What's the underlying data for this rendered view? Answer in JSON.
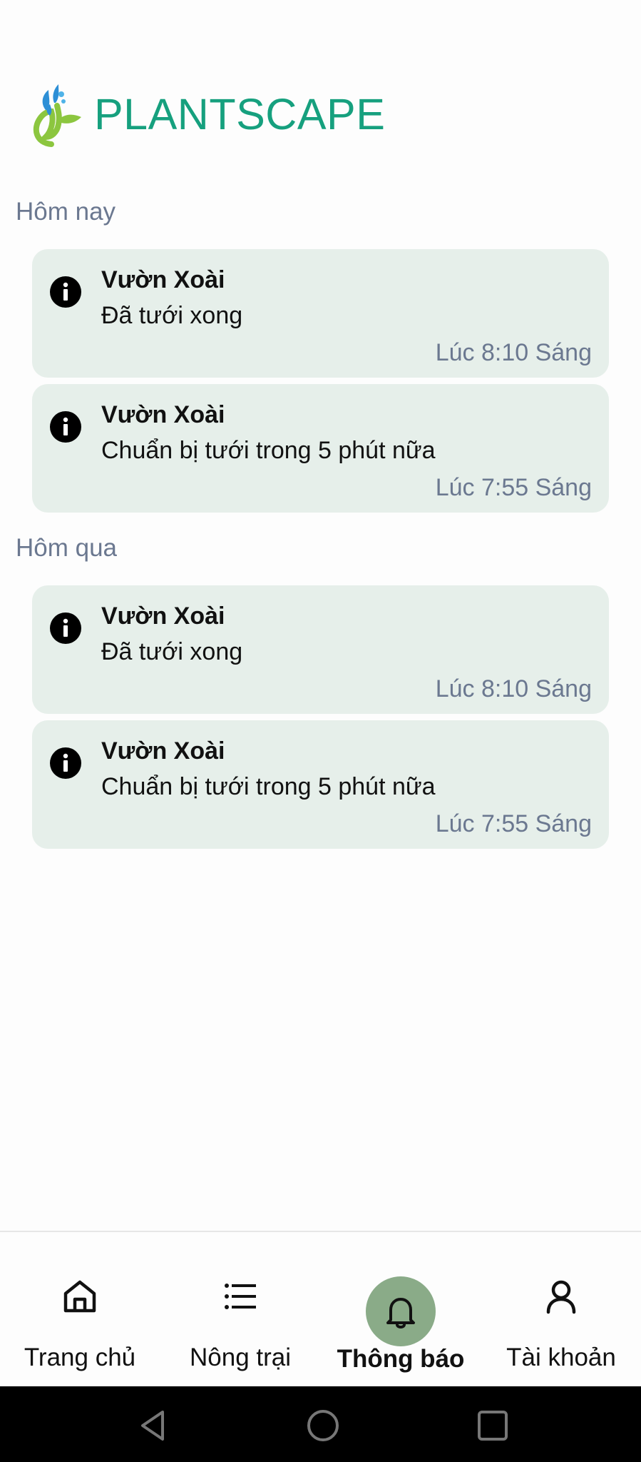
{
  "app": {
    "logo_text": "PLANTSCAPE",
    "brand_color": "#16a07e"
  },
  "sections": [
    {
      "label": "Hôm nay",
      "notifications": [
        {
          "icon": "info-icon",
          "title": "Vườn Xoài",
          "message": "Đã tưới xong",
          "time": "Lúc 8:10 Sáng"
        },
        {
          "icon": "info-icon",
          "title": "Vườn Xoài",
          "message": "Chuẩn bị tưới trong 5 phút nữa",
          "time": "Lúc 7:55 Sáng"
        }
      ]
    },
    {
      "label": "Hôm qua",
      "notifications": [
        {
          "icon": "info-icon",
          "title": "Vườn Xoài",
          "message": "Đã tưới xong",
          "time": "Lúc 8:10 Sáng"
        },
        {
          "icon": "info-icon",
          "title": "Vườn Xoài",
          "message": "Chuẩn bị tưới trong 5 phút nữa",
          "time": "Lúc 7:55 Sáng"
        }
      ]
    }
  ],
  "nav": {
    "items": [
      {
        "icon": "home-icon",
        "label": "Trang chủ",
        "active": false
      },
      {
        "icon": "list-icon",
        "label": "Nông trại",
        "active": false
      },
      {
        "icon": "bell-icon",
        "label": "Thông báo",
        "active": true
      },
      {
        "icon": "user-icon",
        "label": "Tài khoản",
        "active": false
      }
    ],
    "active_color": "#8aab88"
  },
  "system_nav": {
    "buttons": [
      "back-icon",
      "home-circle-icon",
      "recents-icon"
    ]
  }
}
